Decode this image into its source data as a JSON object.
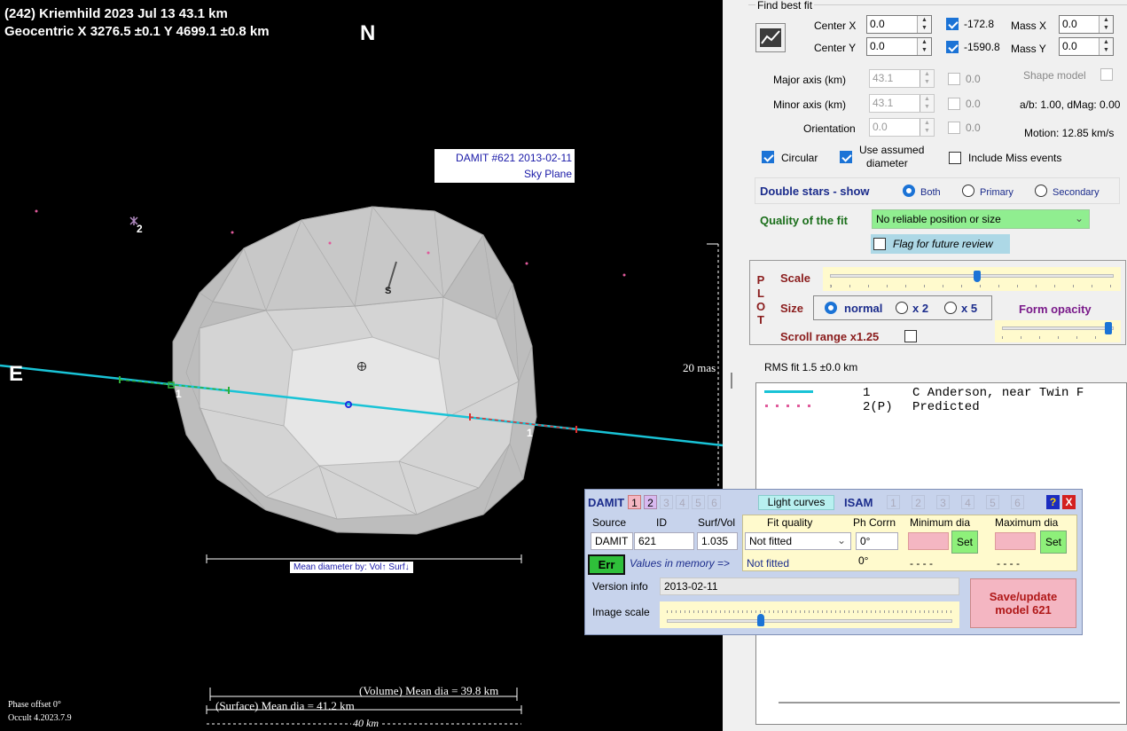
{
  "plot": {
    "title_line1": "(242) Kriemhild  2023 Jul 13  43.1 km",
    "title_line2": "Geocentric  X  3276.5 ±0.1  Y 4699.1 ±0.8 km",
    "north_label": "N",
    "east_label": "E",
    "model_label_line1": "DAMIT #621 2013-02-11",
    "model_label_line2": "Sky Plane",
    "star2_label": "2",
    "chord1_label": "1",
    "chord1b_label": "1",
    "spin_label": "S",
    "scale_mas": "20 mas",
    "mean_dia_bar_label": "Mean diameter by: Vol↑ Surf↓",
    "volume_mean": "(Volume) Mean dia = 39.8 km",
    "surface_mean": "(Surface) Mean dia = 41.2 km",
    "km_scale": "40 km",
    "phase_offset": "Phase offset 0°",
    "version": "Occult 4.2023.7.9"
  },
  "fit": {
    "group_title": "Find best fit",
    "center_x_label": "Center X",
    "center_x": "0.0",
    "center_y_label": "Center Y",
    "center_y": "0.0",
    "cx_value": "-172.8",
    "cy_value": "-1590.8",
    "mass_x_label": "Mass X",
    "mass_x": "0.0",
    "mass_y_label": "Mass Y",
    "mass_y": "0.0",
    "major_label": "Major axis (km)",
    "major": "43.1",
    "minor_label": "Minor axis (km)",
    "minor": "43.1",
    "orient_label": "Orientation",
    "orient": "0.0",
    "major_chk": "0.0",
    "minor_chk": "0.0",
    "orient_chk": "0.0",
    "shape_model_label": "Shape model",
    "ab_dmag": "a/b: 1.00, dMag: 0.00",
    "motion": "Motion: 12.85 km/s",
    "circular_label": "Circular",
    "use_assumed_label_1": "Use assumed",
    "use_assumed_label_2": "diameter",
    "include_miss_label": "Include Miss events"
  },
  "double": {
    "label": "Double stars - show",
    "both": "Both",
    "primary": "Primary",
    "secondary": "Secondary"
  },
  "quality": {
    "label": "Quality of the fit",
    "value": "No reliable position or size",
    "flag_label": "Flag for future review"
  },
  "plotctl": {
    "vertical": [
      "P",
      "L",
      "O",
      "T"
    ],
    "scale_label": "Scale",
    "size_label": "Size",
    "normal": "normal",
    "x2": "x 2",
    "x5": "x 5",
    "opacity_label": "Form opacity",
    "scroll_label": "Scroll range x1.25",
    "scale_level": 0.52,
    "opacity_level": 0.95
  },
  "rms": {
    "label": "RMS fit 1.5 ±0.0 km"
  },
  "legend": [
    {
      "num": "1",
      "text": "C Anderson, near Twin F"
    },
    {
      "num": "2(P)",
      "text": "Predicted"
    }
  ],
  "damit": {
    "title": "DAMIT",
    "models": [
      "1",
      "2",
      "3",
      "4",
      "5",
      "6"
    ],
    "light_curves": "Light curves",
    "isam": "ISAM",
    "isam_models": [
      "1",
      "2",
      "3",
      "4",
      "5",
      "6"
    ],
    "help": "?",
    "close": "X",
    "source_h": "Source",
    "id_h": "ID",
    "surfvol_h": "Surf/Vol",
    "fitq_h": "Fit quality",
    "phcorr_h": "Ph Corrn",
    "mindia_h": "Minimum dia",
    "maxdia_h": "Maximum dia",
    "source": "DAMIT",
    "id": "621",
    "surfvol": "1.035",
    "fitq": "Not fitted",
    "phcorr": "0°",
    "set1": "Set",
    "set2": "Set",
    "err": "Err",
    "mem_label": "Values in memory =>",
    "mem_fitq": "Not fitted",
    "mem_phcorr": "0°",
    "mem_min": "- - - -",
    "mem_max": "- - - -",
    "version_label": "Version info",
    "version": "2013-02-11",
    "imgscale_label": "Image scale",
    "save_line1": "Save/update",
    "save_line2": "model 621",
    "image_scale_level": 0.33
  }
}
